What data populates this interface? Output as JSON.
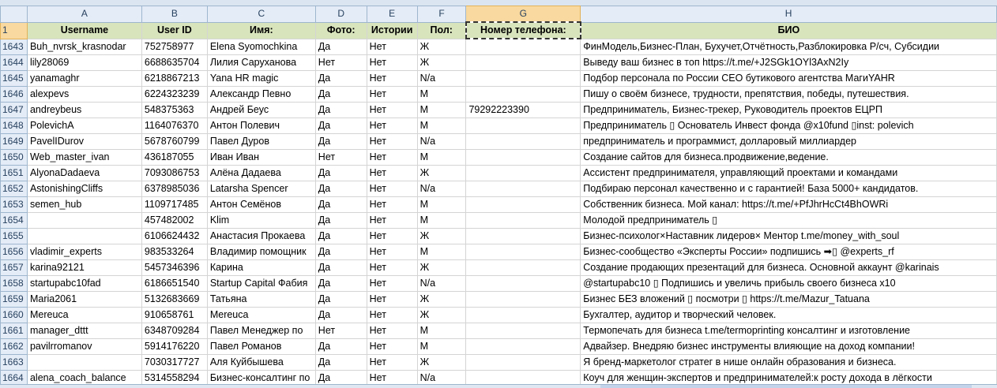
{
  "columns": [
    "A",
    "B",
    "C",
    "D",
    "E",
    "F",
    "G",
    "H"
  ],
  "selected_column": "G",
  "header_row": {
    "number": "1",
    "cells": [
      "Username",
      "User ID",
      "Имя:",
      "Фото:",
      "Истории",
      "Пол:",
      "Номер телефона:",
      "БИО"
    ]
  },
  "rows": [
    {
      "n": "1643",
      "cells": [
        "Buh_nvrsk_krasnodar",
        "752758977",
        "Elena Syomochkina",
        "Да",
        "Нет",
        "Ж",
        "",
        "ФинМодель,Бизнес-План, Бухучет,Отчётность,Разблокировка Р/сч, Субсидии"
      ]
    },
    {
      "n": "1644",
      "cells": [
        "lily28069",
        "6688635704",
        "Лилия Саруханова",
        "Нет",
        "Нет",
        "Ж",
        "",
        "Выведу ваш бизнес в топ https://t.me/+J2SGk1OYl3AxN2Iy"
      ]
    },
    {
      "n": "1645",
      "cells": [
        "yanamaghr",
        "6218867213",
        "Yana HR magic",
        "Да",
        "Нет",
        "N/a",
        "",
        "Подбор персонала по России CEO бутикового агентства МагиYAHR"
      ]
    },
    {
      "n": "1646",
      "cells": [
        "alexpevs",
        "6224323239",
        "Александр Певно",
        "Да",
        "Нет",
        "М",
        "",
        "Пишу о своём бизнесе, трудности, препятствия, победы, путешествия."
      ]
    },
    {
      "n": "1647",
      "cells": [
        "andreybeus",
        "548375363",
        "Андрей Беус",
        "Да",
        "Нет",
        "М",
        "79292223390",
        "Предприниматель, Бизнес-трекер, Руководитель проектов ЕЦРП"
      ]
    },
    {
      "n": "1648",
      "cells": [
        "PolevichA",
        "1164076370",
        "Антон Полевич",
        "Да",
        "Нет",
        "М",
        "",
        "Предприниматель ▯ Основатель Инвест фонда @x10fund ▯inst: polevich"
      ]
    },
    {
      "n": "1649",
      "cells": [
        "PavelIDurov",
        "5678760799",
        "Павел Дуров",
        "Да",
        "Нет",
        "N/a",
        "",
        "предприниматель и программист, долларовый миллиардер"
      ]
    },
    {
      "n": "1650",
      "cells": [
        "Web_master_ivan",
        "436187055",
        "Иван Иван",
        "Нет",
        "Нет",
        "М",
        "",
        "Создание сайтов для бизнеса.продвижение,ведение."
      ]
    },
    {
      "n": "1651",
      "cells": [
        "AlyonaDadaeva",
        "7093086753",
        "Алёна Дадаева",
        "Да",
        "Нет",
        "Ж",
        "",
        "Ассистент предпринимателя, управляющий проектами и командами"
      ]
    },
    {
      "n": "1652",
      "cells": [
        "AstonishingCliffs",
        "6378985036",
        "Latarsha Spencer",
        "Да",
        "Нет",
        "N/a",
        "",
        "Подбираю персонал качественно и с гарантией! База 5000+ кандидатов."
      ]
    },
    {
      "n": "1653",
      "cells": [
        "semen_hub",
        "1109717485",
        "Антон Семёнов",
        "Да",
        "Нет",
        "М",
        "",
        "Собственник бизнеса. Мой канал: https://t.me/+PfJhrHcCt4BhOWRi"
      ]
    },
    {
      "n": "1654",
      "cells": [
        "",
        "457482002",
        "Klim",
        "Да",
        "Нет",
        "М",
        "",
        "Молодой предприниматель ▯"
      ]
    },
    {
      "n": "1655",
      "cells": [
        "",
        "6106624432",
        "Анастасия Прокаева",
        "Да",
        "Нет",
        "Ж",
        "",
        "Бизнес-психолог×Наставник лидеров× Ментор t.me/money_with_soul"
      ]
    },
    {
      "n": "1656",
      "cells": [
        "vladimir_experts",
        "983533264",
        "Владимир помощник",
        "Да",
        "Нет",
        "М",
        "",
        "Бизнес-сообщество «Эксперты России» подпишись ➡▯ @experts_rf"
      ]
    },
    {
      "n": "1657",
      "cells": [
        "karina92121",
        "5457346396",
        "Карина",
        "Да",
        "Нет",
        "Ж",
        "",
        "Создание продающих презентаций для бизнеса. Основной аккаунт @karinais"
      ]
    },
    {
      "n": "1658",
      "cells": [
        "startupabc10fad",
        "6186651540",
        "Startup Capital Фабия",
        "Да",
        "Нет",
        "N/a",
        "",
        "@startupabc10 ▯ Подпишись и увеличь прибыль своего бизнеса x10"
      ]
    },
    {
      "n": "1659",
      "cells": [
        "Maria2061",
        "5132683669",
        "Татьяна",
        "Да",
        "Нет",
        "Ж",
        "",
        "Бизнес БЕЗ вложений ▯ посмотри ▯ https://t.me/Mazur_Tatuana"
      ]
    },
    {
      "n": "1660",
      "cells": [
        "Mereuca",
        "910658761",
        "Mereuca",
        "Да",
        "Нет",
        "Ж",
        "",
        "Бухгалтер, аудитор и творческий человек."
      ]
    },
    {
      "n": "1661",
      "cells": [
        "manager_dttt",
        "6348709284",
        "Павел Менеджер по",
        "Нет",
        "Нет",
        "М",
        "",
        "Термопечать для бизнеса t.me/termoprinting консалтинг и изготовление"
      ]
    },
    {
      "n": "1662",
      "cells": [
        "pavilrromanov",
        "5914176220",
        "Павел Романов",
        "Да",
        "Нет",
        "М",
        "",
        "Адвайзер. Внедряю бизнес инструменты влияющие на доход компании!"
      ]
    },
    {
      "n": "1663",
      "cells": [
        "",
        "7030317727",
        "Аля Куйбышева",
        "Да",
        "Нет",
        "Ж",
        "",
        "Я бренд-маркетолог стратег в нише онлайн образования и бизнеса."
      ]
    },
    {
      "n": "1664",
      "cells": [
        "alena_coach_balance",
        "5314558294",
        "Бизнес-консалтинг по",
        "Да",
        "Нет",
        "N/a",
        "",
        "Коуч для женщин-экспертов и предпринимателей:к росту дохода в лёгкости"
      ]
    }
  ]
}
